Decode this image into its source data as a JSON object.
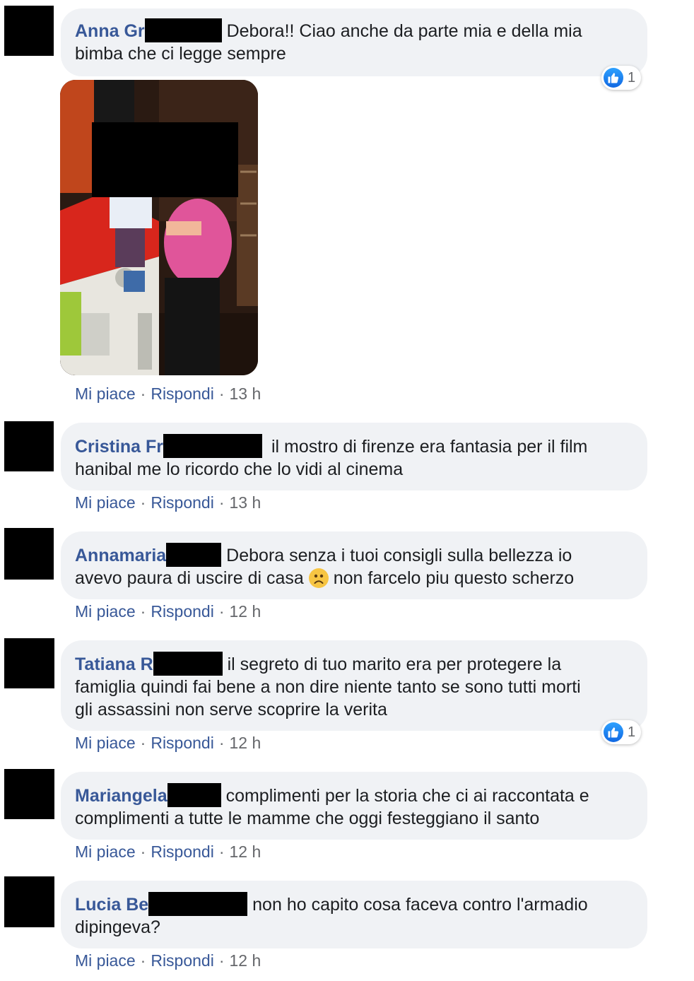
{
  "actions": {
    "like": "Mi piace",
    "reply": "Rispondi",
    "separator": "·"
  },
  "comments": [
    {
      "author": "Anna Gr",
      "text_line1": "Debora!! Ciao anche da parte mia e della mia",
      "text_line2": "bimba che ci legge sempre",
      "time": "13 h",
      "reaction_count": "1"
    },
    {
      "author": "Cristina Fr",
      "text_line1": "il mostro di firenze era fantasia per il film",
      "text_line2": "hanibal me lo ricordo che lo vidi al cinema",
      "time": "13 h"
    },
    {
      "author": "Annamaria",
      "text_line1": "Debora senza i tuoi consigli sulla bellezza io",
      "text_line2_a": "avevo paura di uscire di casa",
      "text_line2_b": "non farcelo piu questo scherzo",
      "time": "12 h"
    },
    {
      "author": "Tatiana R",
      "text_line1": "il segreto di tuo marito era per protegere la",
      "text_line2": "famiglia quindi fai bene a non dire niente tanto se sono tutti morti",
      "text_line3": "gli assassini non serve scoprire la verita",
      "time": "12 h",
      "reaction_count": "1"
    },
    {
      "author": "Mariangela",
      "text_line1": "complimenti per la storia che ci ai raccontata e",
      "text_line2": "complimenti a tutte le mamme che oggi festeggiano il santo",
      "time": "12 h"
    },
    {
      "author": "Lucia Be",
      "text_line1": "non ho capito cosa faceva contro l'armadio",
      "text_line2": "dipingeva?",
      "time": "12 h"
    }
  ],
  "colors": {
    "link": "#385898",
    "bubble": "#f0f2f5",
    "meta": "#65676b",
    "like": "#1877f2"
  },
  "icons": {
    "reaction": "like-thumbs-up-icon",
    "emoji": "frowning-face-icon"
  }
}
